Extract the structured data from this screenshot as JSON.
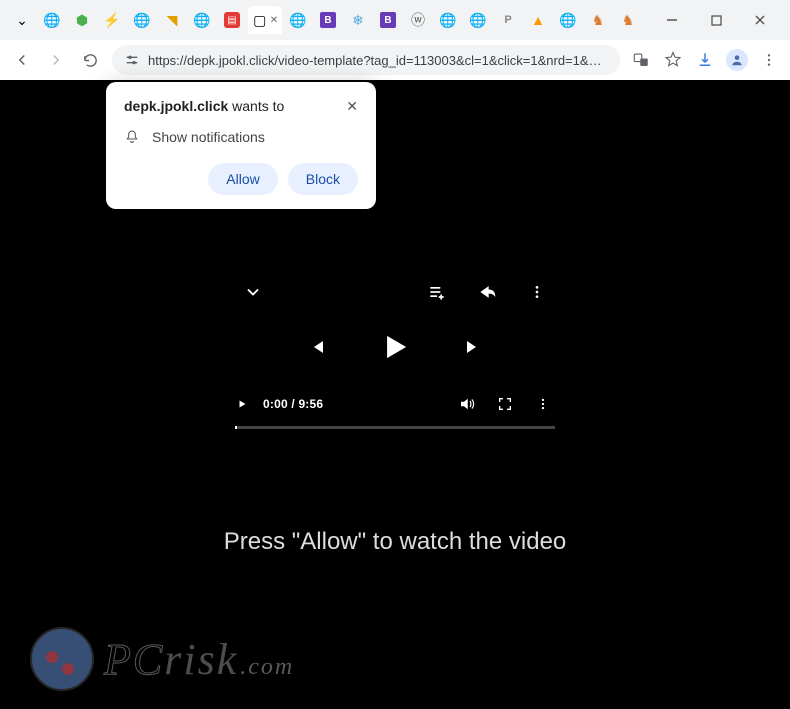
{
  "browser": {
    "url": "https://depk.jpokl.click/video-template?tag_id=113003&cl=1&click=1&nrd=1&utm_source..."
  },
  "permission": {
    "site": "depk.jpokl.click",
    "wants_to": " wants to",
    "option": "Show notifications",
    "allow": "Allow",
    "block": "Block"
  },
  "player": {
    "current_time": "0:00",
    "duration": "9:56"
  },
  "message": "Press \"Allow\" to watch the video",
  "watermark": {
    "outline": "PC",
    "rest": "risk",
    "dotcom": ".com"
  }
}
